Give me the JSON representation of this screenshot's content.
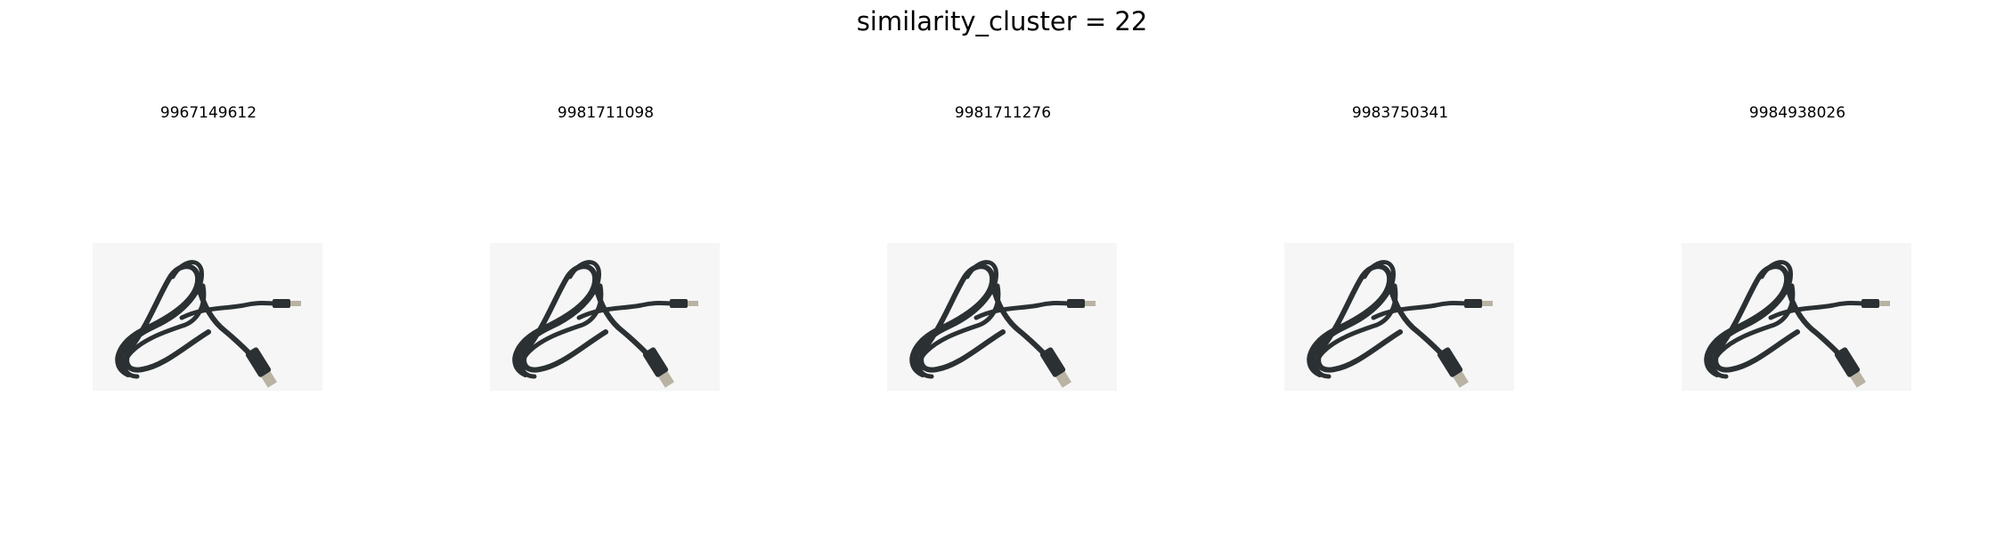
{
  "figure": {
    "title": "similarity_cluster = 22"
  },
  "panels": [
    {
      "label": "9967149612",
      "image": "usb-cable-image"
    },
    {
      "label": "9981711098",
      "image": "usb-cable-image"
    },
    {
      "label": "9981711276",
      "image": "usb-cable-image"
    },
    {
      "label": "9983750341",
      "image": "usb-cable-image"
    },
    {
      "label": "9984938026",
      "image": "usb-cable-image"
    }
  ],
  "colors": {
    "background": "#ffffff",
    "thumbnail_background": "#f6f6f6",
    "cable": "#2b3033",
    "connector_metal": "#b9b3a3"
  }
}
